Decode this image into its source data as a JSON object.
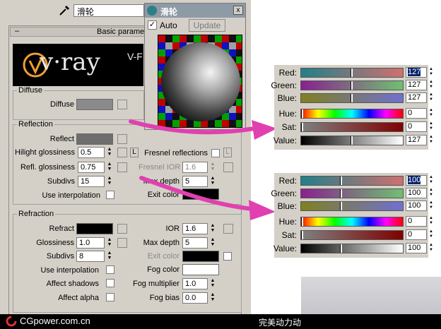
{
  "material_name": "滑轮",
  "rollout": {
    "minus": "–",
    "title": "Basic parame"
  },
  "logo": {
    "text": "v·ray",
    "suffix": "V-F"
  },
  "diffuse": {
    "group": "Diffuse",
    "label": "Diffuse",
    "swatch_color": "#8a8a8a"
  },
  "reflection": {
    "group": "Reflection",
    "reflect_label": "Reflect",
    "reflect_color": "#6e6e6e",
    "hilight_label": "Hilight glossiness",
    "hilight_value": "0.5",
    "fresnel_label": "Fresnel reflections",
    "l_btn": "L",
    "refl_gloss_label": "Refl. glossiness",
    "refl_gloss_value": "0.75",
    "fresnel_ior_label": "Fresnel IOR",
    "fresnel_ior_value": "1.6",
    "subdivs_label": "Subdivs",
    "subdivs_value": "15",
    "max_depth_label": "Max depth",
    "max_depth_value": "5",
    "use_interp_label": "Use interpolation",
    "exit_color_label": "Exit color",
    "exit_color": "#000000"
  },
  "refraction": {
    "group": "Refraction",
    "refract_label": "Refract",
    "refract_color": "#000000",
    "ior_label": "IOR",
    "ior_value": "1.6",
    "gloss_label": "Glossiness",
    "gloss_value": "1.0",
    "max_depth_label": "Max depth",
    "max_depth_value": "5",
    "subdivs_label": "Subdivs",
    "subdivs_value": "8",
    "exit_color_label": "Exit color",
    "exit_color": "#000000",
    "use_interp_label": "Use interpolation",
    "fog_color_label": "Fog color",
    "fog_color": "#ffffff",
    "affect_shadows_label": "Affect shadows",
    "fog_mult_label": "Fog multiplier",
    "fog_mult_value": "1.0",
    "affect_alpha_label": "Affect alpha",
    "fog_bias_label": "Fog bias",
    "fog_bias_value": "0.0"
  },
  "preview": {
    "title": "滑轮",
    "close": "x",
    "auto_label": "Auto",
    "update_label": "Update"
  },
  "color1": {
    "labels": [
      "Red:",
      "Green:",
      "Blue:",
      "Hue:",
      "Sat:",
      "Value:"
    ],
    "values": [
      "127",
      "127",
      "127",
      "0",
      "0",
      "127"
    ],
    "levels": [
      0.5,
      0.5,
      0.5,
      0,
      0,
      0.5
    ]
  },
  "color2": {
    "labels": [
      "Red:",
      "Green:",
      "Blue:",
      "Hue:",
      "Sat:",
      "Value:"
    ],
    "values": [
      "100",
      "100",
      "100",
      "0",
      "0",
      "100"
    ],
    "levels": [
      0.39,
      0.39,
      0.39,
      0,
      0,
      0.39
    ]
  },
  "footer": {
    "site": "CGpower.com.cn",
    "right_text": "完美动力动"
  }
}
